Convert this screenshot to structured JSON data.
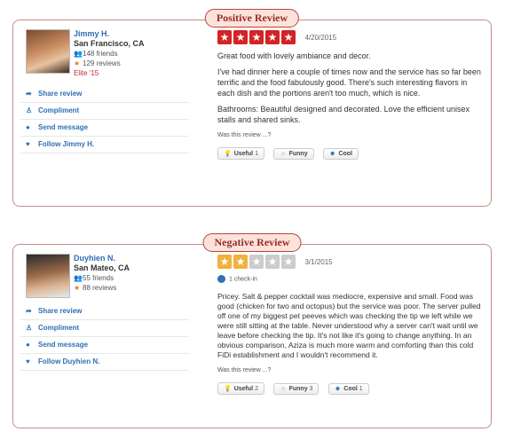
{
  "reviews": [
    {
      "banner": "Positive Review",
      "user": {
        "name": "Jimmy H.",
        "location": "San Francisco, CA",
        "friends": "148 friends",
        "reviews": "129 reviews",
        "elite": "Elite '15"
      },
      "actions": [
        "Share review",
        "Compliment",
        "Send message",
        "Follow Jimmy H."
      ],
      "rating": 5,
      "star_color": "#d32323",
      "date": "4/20/2015",
      "checkin": "",
      "paragraphs": [
        "Great food with lovely ambiance and decor.",
        "I've had dinner here a couple of times now and the service has so far been terrific and the food fabulously good. There's such interesting flavors in each dish and the portions aren't too much, which is nice.",
        "Bathrooms: Beautiful designed and decorated. Love the efficient unisex stalls and shared sinks."
      ],
      "was_this_review": "Was this review ...?",
      "votes": {
        "useful_label": "Useful",
        "useful_count": "1",
        "funny_label": "Funny",
        "funny_count": "",
        "cool_label": "Cool",
        "cool_count": ""
      }
    },
    {
      "banner": "Negative Review",
      "user": {
        "name": "Duyhien N.",
        "location": "San Mateo, CA",
        "friends": "55 friends",
        "reviews": "88 reviews",
        "elite": ""
      },
      "actions": [
        "Share review",
        "Compliment",
        "Send message",
        "Follow Duyhien N."
      ],
      "rating": 2,
      "star_color": "#f0b23d",
      "date": "3/1/2015",
      "checkin": "1 check-in",
      "paragraphs": [
        "Pricey.  Salt & pepper cocktail was mediocre, expensive and small.  Food was good (chicken for two and octopus) but the service was poor. The server pulled off one of my biggest pet peeves which was checking the tip we left while we were still sitting at the table. Never understood why a server can't wait until we leave before checking the tip. It's not like it's going to change anything.  In an obvious comparison, Aziza is much more warm and comforting than this cold FiDi establishment and I wouldn't recommend it."
      ],
      "was_this_review": "Was this review ...?",
      "votes": {
        "useful_label": "Useful",
        "useful_count": "2",
        "funny_label": "Funny",
        "funny_count": "3",
        "cool_label": "Cool",
        "cool_count": "1"
      }
    }
  ]
}
